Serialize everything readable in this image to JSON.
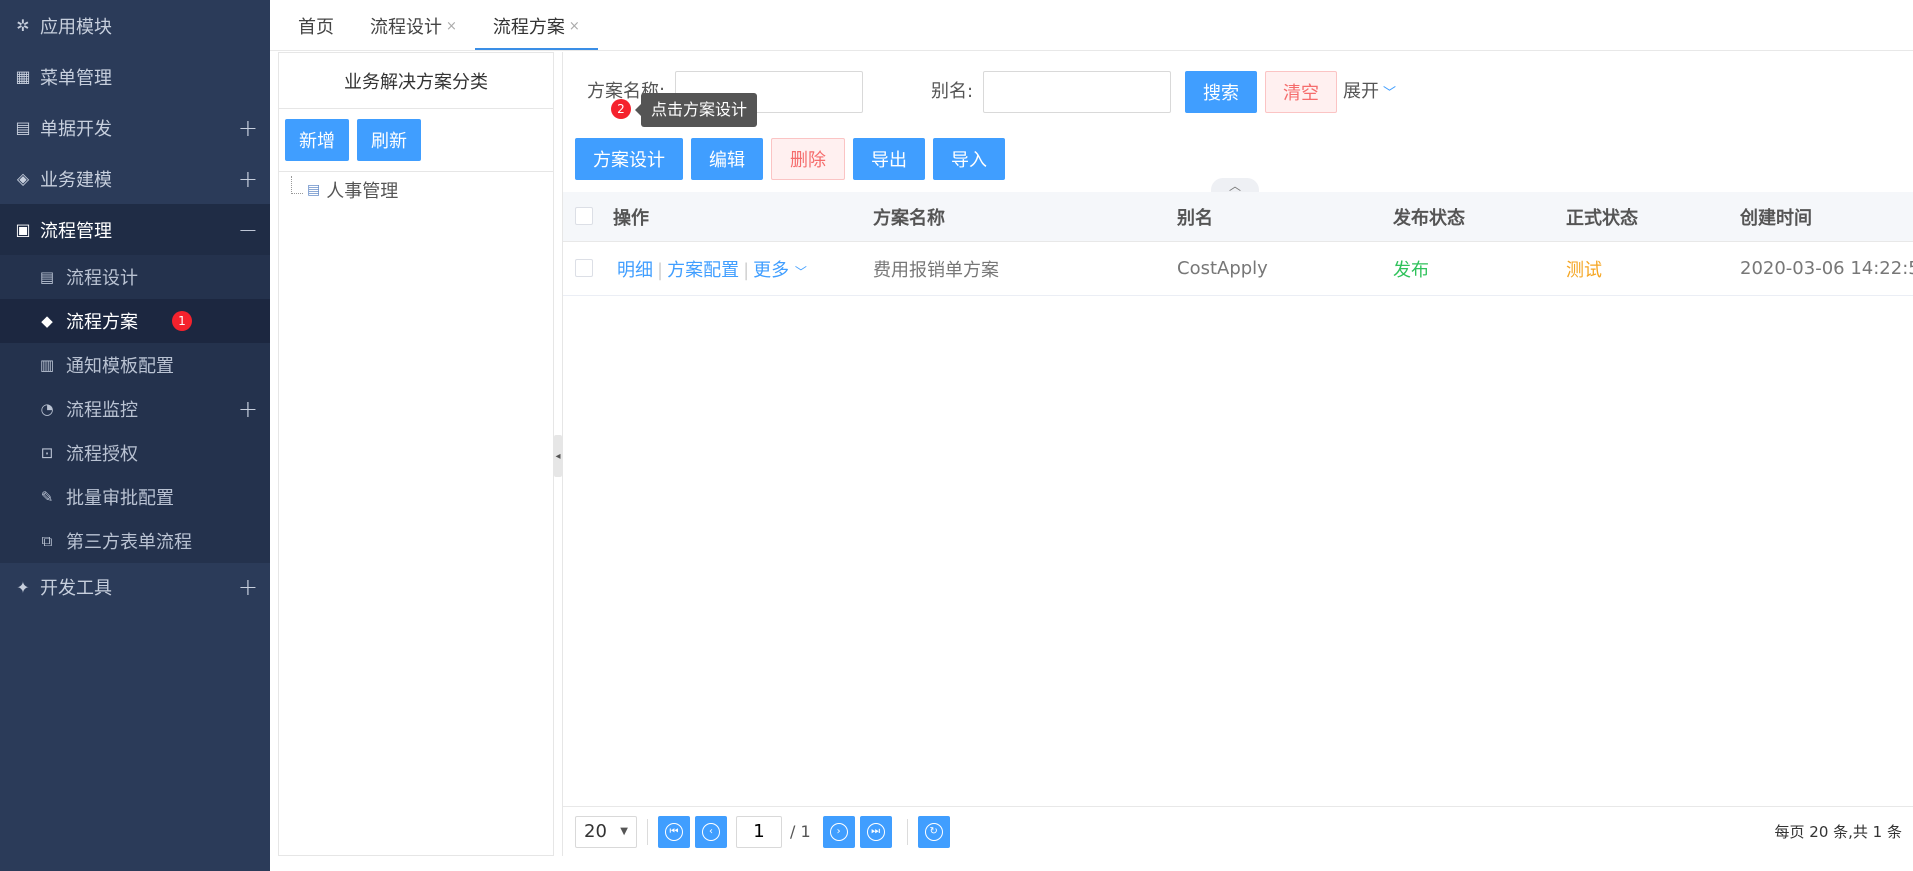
{
  "sidebar": {
    "items": [
      {
        "label": "应用模块",
        "icon": "app-module-icon"
      },
      {
        "label": "菜单管理",
        "icon": "grid-icon"
      },
      {
        "label": "单据开发",
        "icon": "document-icon",
        "expand": "+"
      },
      {
        "label": "业务建模",
        "icon": "cube-icon",
        "expand": "+"
      },
      {
        "label": "流程管理",
        "icon": "workflow-icon",
        "expand": "−"
      }
    ],
    "subitems": [
      {
        "label": "流程设计",
        "icon": "file-icon"
      },
      {
        "label": "流程方案",
        "icon": "box-icon",
        "badge": "1"
      },
      {
        "label": "通知模板配置",
        "icon": "template-icon"
      },
      {
        "label": "流程监控",
        "icon": "monitor-icon",
        "expand": "+"
      },
      {
        "label": "流程授权",
        "icon": "authorize-icon"
      },
      {
        "label": "批量审批配置",
        "icon": "edit-icon"
      },
      {
        "label": "第三方表单流程",
        "icon": "flow-icon"
      }
    ],
    "devtools": {
      "label": "开发工具",
      "icon": "wrench-icon",
      "expand": "+"
    }
  },
  "tabs": [
    {
      "label": "首页"
    },
    {
      "label": "流程设计",
      "close": "×"
    },
    {
      "label": "流程方案",
      "close": "×"
    }
  ],
  "left_panel": {
    "title": "业务解决方案分类",
    "add_label": "新增",
    "refresh_label": "刷新",
    "tree": [
      {
        "label": "人事管理"
      }
    ]
  },
  "search": {
    "name_label": "方案名称:",
    "name_value": "",
    "alias_label": "别名:",
    "alias_value": "",
    "search_label": "搜索",
    "clear_label": "清空",
    "expand_label": "展开"
  },
  "tooltip": {
    "step": "2",
    "text": "点击方案设计"
  },
  "toolbar": {
    "design_label": "方案设计",
    "edit_label": "编辑",
    "delete_label": "删除",
    "export_label": "导出",
    "import_label": "导入"
  },
  "grid": {
    "headers": {
      "op": "操作",
      "name": "方案名称",
      "alias": "别名",
      "publish": "发布状态",
      "formal": "正式状态",
      "created": "创建时间"
    },
    "rows": [
      {
        "op_detail": "明细",
        "op_config": "方案配置",
        "op_more": "更多",
        "name": "费用报销单方案",
        "alias": "CostApply",
        "publish": "发布",
        "formal": "测试",
        "created": "2020-03-06 14:22:5"
      }
    ]
  },
  "pager": {
    "page_size": "20",
    "current_page": "1",
    "total_pages": "/ 1",
    "info": "每页 20 条,共 1 条"
  },
  "colors": {
    "sidebar_bg": "#2b3b59",
    "primary": "#409eff",
    "danger": "#f56c6c",
    "success": "#2fc25b",
    "warning": "#f5a623"
  }
}
